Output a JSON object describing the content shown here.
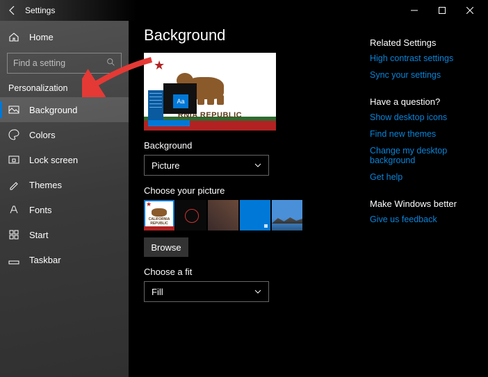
{
  "window": {
    "title": "Settings"
  },
  "home": {
    "label": "Home"
  },
  "search": {
    "placeholder": "Find a setting"
  },
  "section_label": "Personalization",
  "nav": [
    {
      "label": "Background",
      "icon": "background-icon",
      "active": true
    },
    {
      "label": "Colors",
      "icon": "colors-icon"
    },
    {
      "label": "Lock screen",
      "icon": "lock-screen-icon"
    },
    {
      "label": "Themes",
      "icon": "themes-icon"
    },
    {
      "label": "Fonts",
      "icon": "fonts-icon"
    },
    {
      "label": "Start",
      "icon": "start-icon"
    },
    {
      "label": "Taskbar",
      "icon": "taskbar-icon"
    }
  ],
  "page": {
    "title": "Background",
    "preview_tile_label": "Aa",
    "preview_flag_text": "RNIA REPUBLIC",
    "background_label": "Background",
    "background_value": "Picture",
    "choose_picture_label": "Choose your picture",
    "thumb_flag_text": "CALIFORNIA REPUBLIC",
    "browse_label": "Browse",
    "fit_label": "Choose a fit",
    "fit_value": "Fill"
  },
  "right": {
    "related": {
      "heading": "Related Settings",
      "links": [
        "High contrast settings",
        "Sync your settings"
      ]
    },
    "question": {
      "heading": "Have a question?",
      "links": [
        "Show desktop icons",
        "Find new themes",
        "Change my desktop background",
        "Get help"
      ]
    },
    "better": {
      "heading": "Make Windows better",
      "links": [
        "Give us feedback"
      ]
    }
  }
}
